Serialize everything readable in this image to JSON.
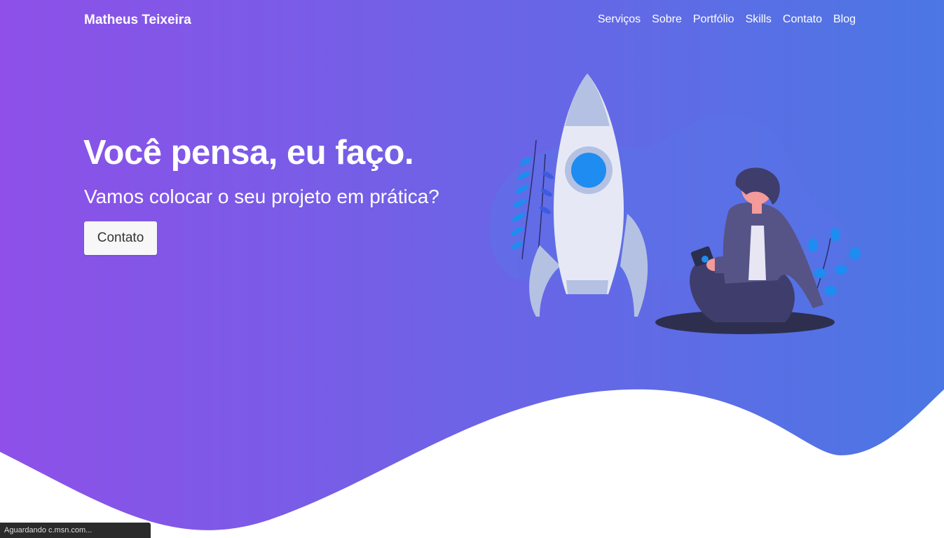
{
  "nav": {
    "brand": "Matheus Teixeira",
    "links": [
      "Serviços",
      "Sobre",
      "Portfólio",
      "Skills",
      "Contato",
      "Blog"
    ]
  },
  "hero": {
    "headline": "Você pensa, eu faço.",
    "subheadline": "Vamos colocar o seu projeto em prática?",
    "cta_label": "Contato"
  },
  "status_bar": {
    "text": "Aguardando c.msn.com..."
  },
  "colors": {
    "gradient_start": "#8e50e8",
    "gradient_end": "#4b77e4",
    "button_bg": "#f7f7f7"
  },
  "icons": {
    "illustration": "rocket-and-person-illustration"
  }
}
